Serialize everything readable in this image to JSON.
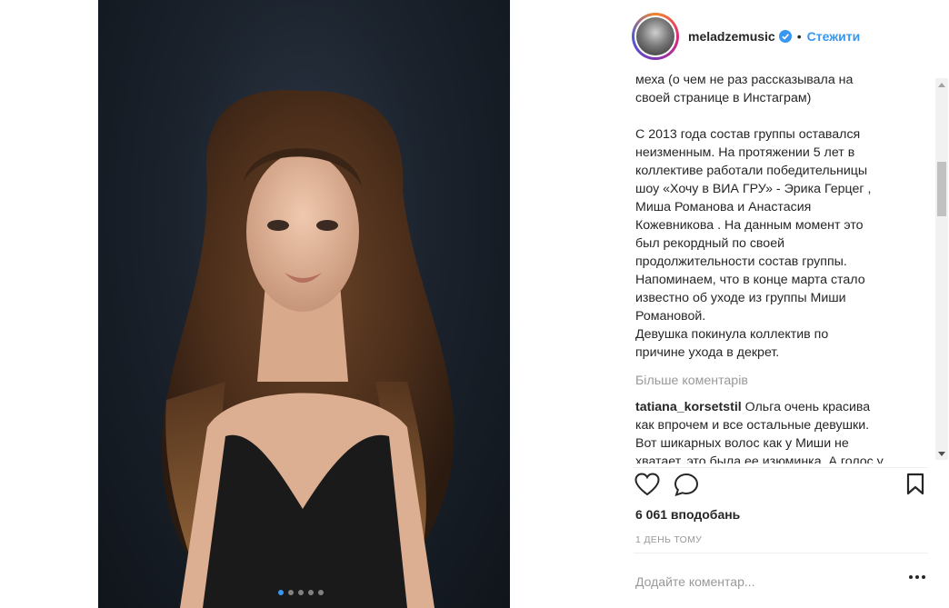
{
  "post": {
    "photo_alt": "woman-portrait",
    "carousel_count": 5,
    "carousel_active_index": 0
  },
  "header": {
    "username": "meladzemusic",
    "separator": "•",
    "follow_label": "Стежити",
    "verified_icon": "verified-badge-icon"
  },
  "caption": {
    "lines": [
      "меха (о чем не раз рассказывала на",
      "своей странице в Инстаграм)",
      "",
      "С 2013 года состав группы оставался",
      "неизменным. На протяжении 5 лет в",
      "коллективе работали победительницы",
      "шоу «Хочу в ВИА ГРУ» - Эрика Герцег ,",
      "Миша Романова и Анастасия",
      "Кожевникова . На данным момент это",
      "был рекордный по своей",
      "продолжительности состав группы.",
      "Напоминаем, что в конце марта стало",
      "известно об уходе из группы Миши",
      "Романовой.",
      "Девушка покинула коллектив по",
      "причине ухода в декрет."
    ]
  },
  "comments": {
    "more_label": "Більше коментарів",
    "items": [
      {
        "user": "tatiana_korsetstil",
        "text_lines": [
          "Ольга очень красива",
          "как впрочем и все остальные девушки.",
          "Вот шикарных волос как у Миши не",
          "хватает, это была ее изюминка. А голос у"
        ]
      }
    ]
  },
  "stats": {
    "likes_label": "6 061 вподобань",
    "time_label": "1 ДЕНЬ ТОМУ"
  },
  "composer": {
    "placeholder": "Додайте коментар..."
  },
  "colors": {
    "accent": "#3897f0",
    "text": "#262626",
    "muted": "#999999"
  }
}
